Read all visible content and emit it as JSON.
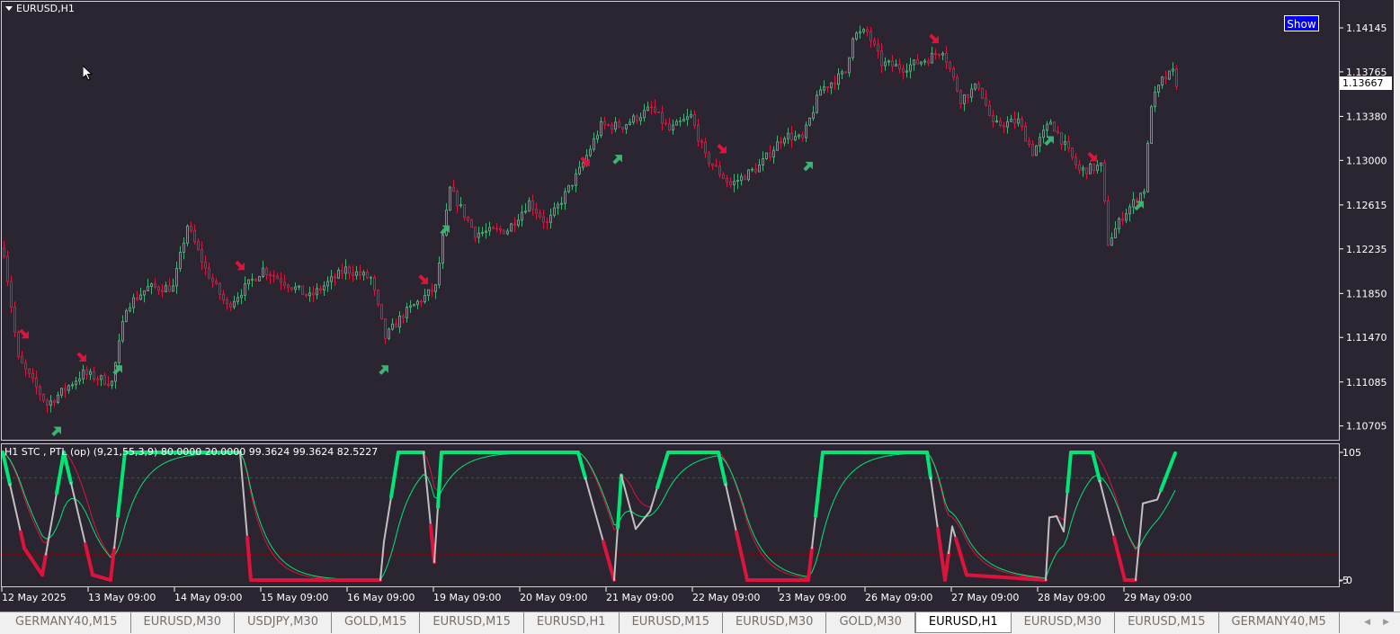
{
  "window": {
    "symbol_title": "EURUSD,H1",
    "show_button": "Show"
  },
  "colors": {
    "background": "#2a2530",
    "bull": "#3cb371",
    "bear": "#dc143c",
    "stc_neutral": "#c0c0c0",
    "stc_up": "#00e676",
    "stc_down": "#dc143c",
    "signal_red": "#dc143c",
    "signal_green": "#00e676",
    "level_high": "#008000",
    "level_low": "#8b0000"
  },
  "price_axis": {
    "labels": [
      "1.14145",
      "1.13765",
      "1.13380",
      "1.13000",
      "1.12615",
      "1.12235",
      "1.11850",
      "1.11470",
      "1.11085",
      "1.10705"
    ],
    "current_price": "1.13667"
  },
  "time_axis": {
    "labels": [
      "12 May 2025",
      "13 May 09:00",
      "14 May 09:00",
      "15 May 09:00",
      "16 May 09:00",
      "19 May 09:00",
      "20 May 09:00",
      "21 May 09:00",
      "22 May 09:00",
      "23 May 09:00",
      "26 May 09:00",
      "27 May 09:00",
      "28 May 09:00",
      "29 May 09:00"
    ]
  },
  "chart_data": [
    {
      "type": "candlestick",
      "timeframe": "H1",
      "ylim": [
        1.10705,
        1.14145
      ],
      "price_path": [
        [
          0,
          1.1221
        ],
        [
          4,
          1.1128
        ],
        [
          12,
          1.1089
        ],
        [
          22,
          1.1116
        ],
        [
          30,
          1.1108
        ],
        [
          34,
          1.1174
        ],
        [
          40,
          1.119
        ],
        [
          47,
          1.119
        ],
        [
          51,
          1.1244
        ],
        [
          56,
          1.1206
        ],
        [
          62,
          1.1174
        ],
        [
          72,
          1.1206
        ],
        [
          85,
          1.1182
        ],
        [
          95,
          1.1206
        ],
        [
          102,
          1.1198
        ],
        [
          106,
          1.1147
        ],
        [
          111,
          1.1167
        ],
        [
          120,
          1.119
        ],
        [
          124,
          1.1275
        ],
        [
          131,
          1.1237
        ],
        [
          140,
          1.124
        ],
        [
          146,
          1.1264
        ],
        [
          151,
          1.1245
        ],
        [
          160,
          1.1291
        ],
        [
          166,
          1.133
        ],
        [
          172,
          1.133
        ],
        [
          180,
          1.1345
        ],
        [
          185,
          1.1326
        ],
        [
          191,
          1.1338
        ],
        [
          195,
          1.1303
        ],
        [
          202,
          1.1279
        ],
        [
          210,
          1.1295
        ],
        [
          217,
          1.1322
        ],
        [
          222,
          1.1318
        ],
        [
          227,
          1.1361
        ],
        [
          234,
          1.1376
        ],
        [
          236,
          1.1408
        ],
        [
          240,
          1.1411
        ],
        [
          244,
          1.1384
        ],
        [
          250,
          1.138
        ],
        [
          257,
          1.1388
        ],
        [
          261,
          1.1396
        ],
        [
          266,
          1.1353
        ],
        [
          271,
          1.1365
        ],
        [
          275,
          1.133
        ],
        [
          282,
          1.1334
        ],
        [
          286,
          1.1307
        ],
        [
          291,
          1.1334
        ],
        [
          299,
          1.1291
        ],
        [
          305,
          1.1295
        ],
        [
          307,
          1.1229
        ],
        [
          311,
          1.1252
        ],
        [
          317,
          1.1275
        ],
        [
          319,
          1.1349
        ],
        [
          322,
          1.1369
        ],
        [
          325,
          1.1376
        ],
        [
          326,
          1.1367
        ]
      ],
      "sell_arrows": [
        [
          6,
          1.115
        ],
        [
          22,
          1.113
        ],
        [
          66,
          1.1209
        ],
        [
          117,
          1.1197
        ],
        [
          162,
          1.1299
        ],
        [
          200,
          1.131
        ],
        [
          259,
          1.1405
        ],
        [
          303,
          1.1303
        ]
      ],
      "buy_arrows": [
        [
          15,
          1.1066
        ],
        [
          32,
          1.1119
        ],
        [
          106,
          1.1119
        ],
        [
          123,
          1.124
        ],
        [
          171,
          1.1301
        ],
        [
          224,
          1.1295
        ],
        [
          291,
          1.1317
        ],
        [
          316,
          1.1261
        ]
      ]
    },
    {
      "type": "line",
      "name": "H1 STC , PTL (op) (9,21,55,3,9) 80.0000 20.0000 99.3624 99.3624 82.5227",
      "ylim": [
        -5,
        105
      ],
      "levels": [
        80,
        20
      ],
      "axis_labels": [
        "105",
        "-5",
        "0"
      ],
      "stc_path": [
        [
          0,
          100
        ],
        [
          6,
          25
        ],
        [
          11,
          4
        ],
        [
          17,
          100
        ],
        [
          25,
          4
        ],
        [
          30,
          0
        ],
        [
          34,
          100
        ],
        [
          66,
          100
        ],
        [
          69,
          0
        ],
        [
          105,
          0
        ],
        [
          106,
          30
        ],
        [
          110,
          100
        ],
        [
          117,
          100
        ],
        [
          120,
          14
        ],
        [
          122,
          100
        ],
        [
          160,
          100
        ],
        [
          170,
          0
        ],
        [
          172,
          82
        ],
        [
          176,
          40
        ],
        [
          180,
          54
        ],
        [
          185,
          100
        ],
        [
          199,
          100
        ],
        [
          207,
          0
        ],
        [
          224,
          0
        ],
        [
          228,
          100
        ],
        [
          257,
          100
        ],
        [
          262,
          0
        ],
        [
          264,
          42
        ],
        [
          268,
          4
        ],
        [
          290,
          0
        ],
        [
          291,
          49
        ],
        [
          293,
          50
        ],
        [
          295,
          38
        ],
        [
          297,
          100
        ],
        [
          303,
          100
        ],
        [
          312,
          0
        ],
        [
          315,
          0
        ],
        [
          317,
          60
        ],
        [
          321,
          63
        ],
        [
          326,
          99.36
        ]
      ]
    }
  ],
  "indicator": {
    "label": "H1 STC , PTL (op) (9,21,55,3,9) 80.0000 20.0000 99.3624 99.3624 82.5227"
  },
  "tabs": [
    {
      "label": "GERMANY40,M15"
    },
    {
      "label": "EURUSD,M30"
    },
    {
      "label": "USDJPY,M30"
    },
    {
      "label": "GOLD,M15"
    },
    {
      "label": "EURUSD,M15"
    },
    {
      "label": "EURUSD,H1"
    },
    {
      "label": "EURUSD,M15"
    },
    {
      "label": "EURUSD,M30"
    },
    {
      "label": "GOLD,M30"
    },
    {
      "label": "EURUSD,H1",
      "active": true
    },
    {
      "label": "EURUSD,M30"
    },
    {
      "label": "EURUSD,M15"
    },
    {
      "label": "GERMANY40,M5"
    }
  ],
  "tab_nav": {
    "prev": "◀",
    "next": "▶"
  }
}
